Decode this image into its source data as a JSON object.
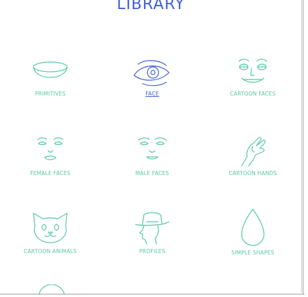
{
  "header": {
    "title": "LIBRARY"
  },
  "library": {
    "items": [
      {
        "label": "PRIMITIVES",
        "icon": "bowl-icon"
      },
      {
        "label": "FACE",
        "icon": "eye-icon",
        "active": true
      },
      {
        "label": "CARTOON FACES",
        "icon": "cartoon-face-icon"
      },
      {
        "label": "FEMALE FACES",
        "icon": "female-face-icon"
      },
      {
        "label": "MALE FACES",
        "icon": "male-face-icon"
      },
      {
        "label": "CARTOON HANDS",
        "icon": "hand-icon"
      },
      {
        "label": "CARTOON ANIMALS",
        "icon": "cat-icon"
      },
      {
        "label": "PROFILES",
        "icon": "profile-hat-icon"
      },
      {
        "label": "SIMPLE SHAPES",
        "icon": "drop-shape-icon"
      }
    ]
  },
  "colors": {
    "accent": "#3f5fd6",
    "icon": "#55c9a6"
  }
}
